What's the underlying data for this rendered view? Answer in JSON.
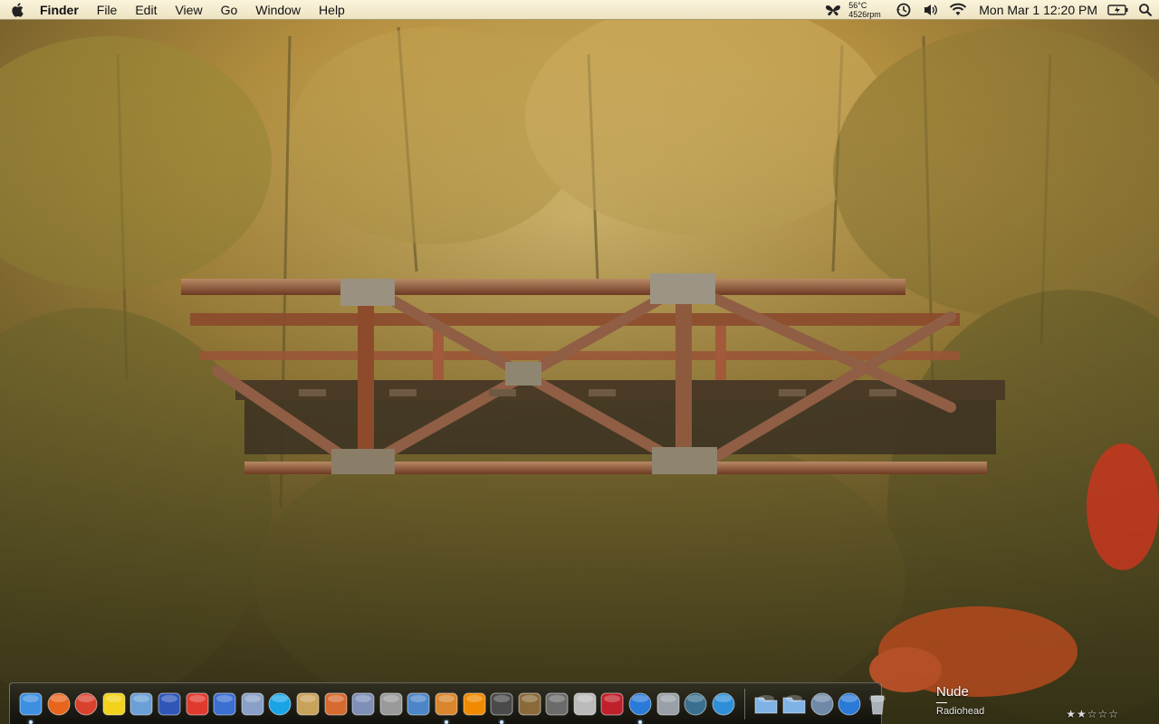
{
  "menubar": {
    "apple_icon": "apple-logo-icon",
    "app_name": "Finder",
    "menus": [
      "File",
      "Edit",
      "View",
      "Go",
      "Window",
      "Help"
    ],
    "status": {
      "temperature": "56°C",
      "fan_speed": "4526rpm",
      "clock": "Mon Mar 1  12:20 PM",
      "icons": [
        "butterfly-icon",
        "time-machine-icon",
        "volume-icon",
        "wifi-icon",
        "battery-icon",
        "spotlight-icon"
      ]
    }
  },
  "dock": {
    "apps": [
      {
        "name": "finder",
        "color": "#3d8fe0"
      },
      {
        "name": "firefox",
        "color": "#e8651c"
      },
      {
        "name": "chrome",
        "color": "#d9412f"
      },
      {
        "name": "growl-yellow",
        "color": "#f2d21a"
      },
      {
        "name": "preview",
        "color": "#6aa0d6"
      },
      {
        "name": "address-book",
        "color": "#2f57b8"
      },
      {
        "name": "ical",
        "color": "#e03a2f"
      },
      {
        "name": "things",
        "color": "#3b6fd0"
      },
      {
        "name": "ichat",
        "color": "#8aa0c8"
      },
      {
        "name": "skype",
        "color": "#1aa4e8"
      },
      {
        "name": "script-editor",
        "color": "#c9a25a"
      },
      {
        "name": "keynote",
        "color": "#d76a30"
      },
      {
        "name": "sketch-app",
        "color": "#7f8fb8"
      },
      {
        "name": "telescope",
        "color": "#9a9a9a"
      },
      {
        "name": "istat",
        "color": "#4d86c7"
      },
      {
        "name": "transmit",
        "color": "#d9862d"
      },
      {
        "name": "vlc",
        "color": "#f08a00"
      },
      {
        "name": "dashboard",
        "color": "#4a4a4a"
      },
      {
        "name": "iphoto",
        "color": "#8b6a3a"
      },
      {
        "name": "imovie",
        "color": "#6b6b6b"
      },
      {
        "name": "dvd-player",
        "color": "#bbbbbb"
      },
      {
        "name": "photo-booth",
        "color": "#c0202a"
      },
      {
        "name": "app-store",
        "color": "#2a7ad8"
      },
      {
        "name": "system-preferences",
        "color": "#9aa0a8"
      },
      {
        "name": "time-machine",
        "color": "#3a6f8f"
      },
      {
        "name": "itunes",
        "color": "#2e8fd8"
      }
    ],
    "stacks": [
      {
        "name": "applications-folder",
        "color": "#7fb2e6"
      },
      {
        "name": "documents-folder",
        "color": "#7fb2e6"
      },
      {
        "name": "downloads-stack",
        "color": "#6f8aa8"
      },
      {
        "name": "app-store-stack",
        "color": "#2a7ad8"
      },
      {
        "name": "trash",
        "color": "#a9b0b8"
      }
    ]
  },
  "now_playing": {
    "title": "Nude",
    "artist": "Radiohead",
    "rating": "★★☆☆☆"
  }
}
